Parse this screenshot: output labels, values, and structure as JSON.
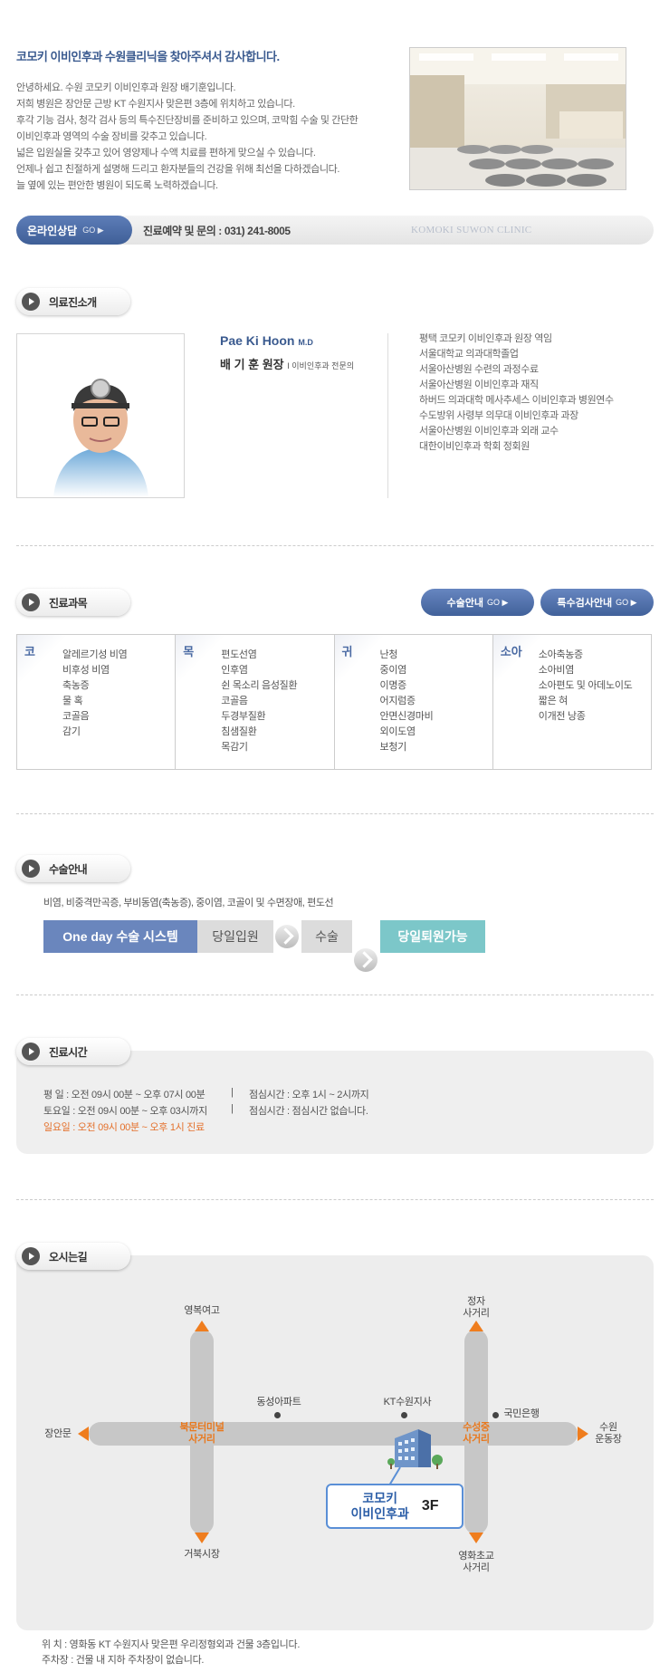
{
  "intro": {
    "title": "코모키 이비인후과 수원클리닉을 찾아주셔서 감사합니다.",
    "lines": [
      "안녕하세요. 수원 코모키 이비인후과 원장 배기훈입니다.",
      "저희 병원은 장안문 근방 KT 수원지사 맞은편 3층에 위치하고 있습니다.",
      "후각 기능 검사, 청각 검사 등의 특수진단장비를 준비하고 있으며, 코막힘 수술 및 간단한",
      "이비인후과 영역의 수술 장비를 갖추고 있습니다.",
      "넓은 입원실을 갖추고 있어 영양제나 수액 치료를 편하게 맞으실 수 있습니다.",
      "언제나 쉽고 친절하게 설명해 드리고 환자분들의 건강을 위해 최선을 다하겠습니다.",
      "늘 옆에 있는 편안한 병원이 되도록 노력하겠습니다."
    ]
  },
  "contact": {
    "online_label": "온라인상담",
    "go": "GO ▶",
    "phone": "진료예약 및 문의 : 031) 241-8005",
    "brand": "KOMOKI SUWON CLINIC"
  },
  "doctor": {
    "section_title": "의료진소개",
    "name_en": "Pae Ki Hoon",
    "name_en_suffix": "M.D",
    "name_ko": "배 기 훈 원장",
    "specialty": "이비인후과 전문의",
    "career": [
      "평택 코모키 이비인후과 원장 역임",
      "서울대학교 의과대학졸업",
      "서울아산병원 수련의 과정수료",
      "서울아산병원 이비인후과 재직",
      "하버드 의과대학 메사추세스 이비인후과 병원연수",
      "수도방위 사령부 의무대 이비인후과 과장",
      "서울아산병원 이비인후과 외래 교수",
      "대한이비인후과 학회 정회원"
    ]
  },
  "departments": {
    "section_title": "진료과목",
    "btn_surgery": "수술안내",
    "btn_special": "특수검사안내",
    "go": "GO ▶",
    "columns": [
      {
        "tag": "코",
        "items": [
          "알레르기성 비염",
          "비후성 비염",
          "축농증",
          "물 혹",
          "코골음",
          "감기"
        ]
      },
      {
        "tag": "목",
        "items": [
          "편도선염",
          "인후염",
          "쉰 목소리 음성질환",
          "코골음",
          "두경부질환",
          "침샘질환",
          "목감기"
        ]
      },
      {
        "tag": "귀",
        "items": [
          "난청",
          "중이염",
          "이명증",
          "어지럼증",
          "안면신경마비",
          "외이도염",
          "보청기"
        ]
      },
      {
        "tag": "소아",
        "items": [
          "소아축농증",
          "소아비염",
          "소아편도 및 아데노이도",
          "짧은 혀",
          "이개전 낭종"
        ]
      }
    ]
  },
  "surgery": {
    "section_title": "수술안내",
    "desc": "비염, 비중격만곡증, 부비동염(축농증), 중이염, 코골이 및 수면장애, 편도선",
    "flow": [
      "One day 수술 시스템",
      "당일입원",
      "수술",
      "당일퇴원가능"
    ]
  },
  "hours": {
    "section_title": "진료시간",
    "rows": [
      {
        "day": "평    일 : 오전 09시 00분 ~ 오후 07시 00분",
        "lunch": "점심시간 : 오후 1시 ~ 2시까지"
      },
      {
        "day": "토요일 : 오전 09시 00분 ~ 오후 03시까지",
        "lunch": "점심시간 : 점심시간 없습니다."
      }
    ],
    "sunday": "일요일 : 오전 09시 00분 ~ 오후 1시 진료",
    "sep": "|"
  },
  "map": {
    "section_title": "오시는길",
    "labels": {
      "north_girls": "영복여고",
      "jeongja": "정자\n사거리",
      "dongseong": "동성아파트",
      "kt": "KT수원지사",
      "kookmin": "국민은행",
      "janganmun": "장안문",
      "bukmun": "북문터미널\n사거리",
      "suseongjung": "수성중\n사거리",
      "suwon_stadium": "수원\n운동장",
      "geobuk": "거북시장",
      "yeonghwa": "영화초교\n사거리",
      "clinic": "코모키\n이비인후과",
      "floor": "3F"
    },
    "location": "위    치 : 영화동 KT 수원지사 맞은편 우리정형외과 건물 3층입니다.",
    "parking": "주차장 : 건물 내 지하 주차장이 없습니다."
  }
}
